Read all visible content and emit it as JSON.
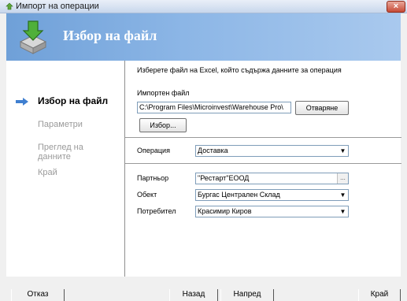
{
  "window": {
    "title": "Импорт на операции",
    "close_label": "×"
  },
  "banner": {
    "title": "Избор на файл"
  },
  "nav": {
    "items": [
      {
        "label": "Избор на файл",
        "active": true
      },
      {
        "label": "Параметри",
        "active": false
      },
      {
        "label": "Преглед на данните",
        "active": false
      },
      {
        "label": "Край",
        "active": false
      }
    ]
  },
  "content": {
    "hint": "Изберете файл на Excel, който съдържа данните за операция",
    "import_file": {
      "label": "Импортен файл",
      "value": "C:\\Program Files\\Microinvest\\Warehouse Pro\\",
      "open_button": "Отваряне",
      "browse_button": "Избор..."
    },
    "operation": {
      "label": "Операция",
      "value": "Доставка"
    },
    "partner": {
      "label": "Партньор",
      "value": "\"Рестарт\"ЕООД",
      "ellipsis": "..."
    },
    "object": {
      "label": "Обект",
      "value": "Бургас Централен Склад"
    },
    "user": {
      "label": "Потребител",
      "value": "Красимир Киров"
    }
  },
  "footer": {
    "cancel": "Отказ",
    "back": "Назад",
    "next": "Напред",
    "finish": "Край"
  },
  "colors": {
    "banner": "#8cb6e6",
    "close": "#c64a36"
  }
}
